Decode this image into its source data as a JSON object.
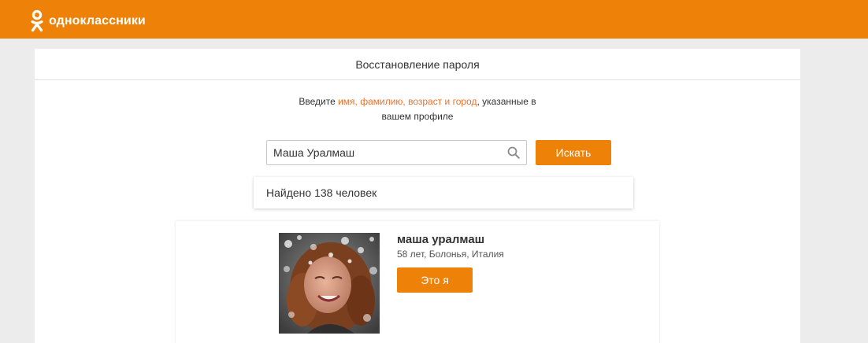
{
  "header": {
    "logo_text": "одноклассники",
    "logo_icon": "ok-logo-icon",
    "brand_color": "#ee8208"
  },
  "page": {
    "title": "Восстановление пароля"
  },
  "instructions": {
    "before": "Введите ",
    "highlight": "имя, фамилию, возраст и город",
    "after": ", указанные в вашем профиле",
    "highlight_color": "#eb722e"
  },
  "search": {
    "value": "Маша Уралмаш",
    "icon": "search-icon",
    "button_label": "Искать"
  },
  "results": {
    "found_text": "Найдено 138 человек",
    "items": [
      {
        "name": "маша уралмаш",
        "meta": "58 лет, Болонья, Италия",
        "button_label": "Это я",
        "avatar": "profile-photo"
      }
    ]
  }
}
